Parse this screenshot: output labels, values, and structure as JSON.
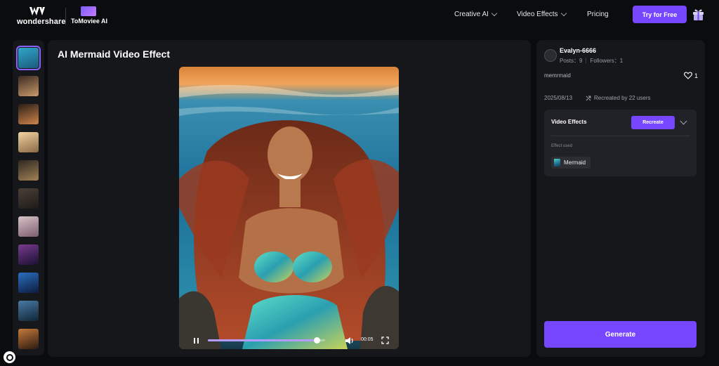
{
  "header": {
    "brand_wondershare": "wondershare",
    "brand_product": "ToMoviee AI",
    "nav": [
      {
        "label": "Creative AI"
      },
      {
        "label": "Video Effects"
      },
      {
        "label": "Pricing"
      }
    ],
    "try_button": "Try for Free",
    "gift_icon": "gift-icon"
  },
  "thumbnails": [
    {
      "name": "thumb-1",
      "colors": [
        "#2fa6c9",
        "#1c5a7a"
      ],
      "active": true
    },
    {
      "name": "thumb-2",
      "colors": [
        "#3b2a22",
        "#c89a6a"
      ]
    },
    {
      "name": "thumb-3",
      "colors": [
        "#2a1d17",
        "#d0854a"
      ]
    },
    {
      "name": "thumb-4",
      "colors": [
        "#f2d3a2",
        "#8a6a45"
      ]
    },
    {
      "name": "thumb-5",
      "colors": [
        "#2e2820",
        "#a28157"
      ]
    },
    {
      "name": "thumb-6",
      "colors": [
        "#4a4038",
        "#1f1a17"
      ]
    },
    {
      "name": "thumb-7",
      "colors": [
        "#d9c3c7",
        "#7b5d6e"
      ]
    },
    {
      "name": "thumb-8",
      "colors": [
        "#7a3b8f",
        "#1a1030"
      ]
    },
    {
      "name": "thumb-9",
      "colors": [
        "#2a6fc0",
        "#0d1b3d"
      ]
    },
    {
      "name": "thumb-10",
      "colors": [
        "#4a7aa4",
        "#0f2436"
      ]
    },
    {
      "name": "thumb-11",
      "colors": [
        "#c67a3b",
        "#2a1a10"
      ]
    }
  ],
  "main": {
    "title": "AI Mermaid Video Effect",
    "player": {
      "progress": 0.93,
      "time": "00:05",
      "pause_icon": "pause-icon",
      "volume_icon": "volume-icon",
      "fullscreen_icon": "fullscreen-icon"
    }
  },
  "sidebar": {
    "username": "Evalyn-6666",
    "posts_label": "Posts：",
    "posts": "9",
    "followers_label": "Followers：",
    "followers": "1",
    "prompt": "memrmaid",
    "likes": "1",
    "date": "2025/08/13",
    "recreated": "Recreated by 22 users",
    "effects_card": {
      "title": "Video Effects",
      "recreate_button": "Recreate",
      "effect_used_label": "Effect used",
      "effect_name": "Mermaid"
    },
    "generate_button": "Generate"
  },
  "colors": {
    "accent": "#7747ff",
    "panel": "#16171b",
    "background": "#0b0c0e"
  }
}
